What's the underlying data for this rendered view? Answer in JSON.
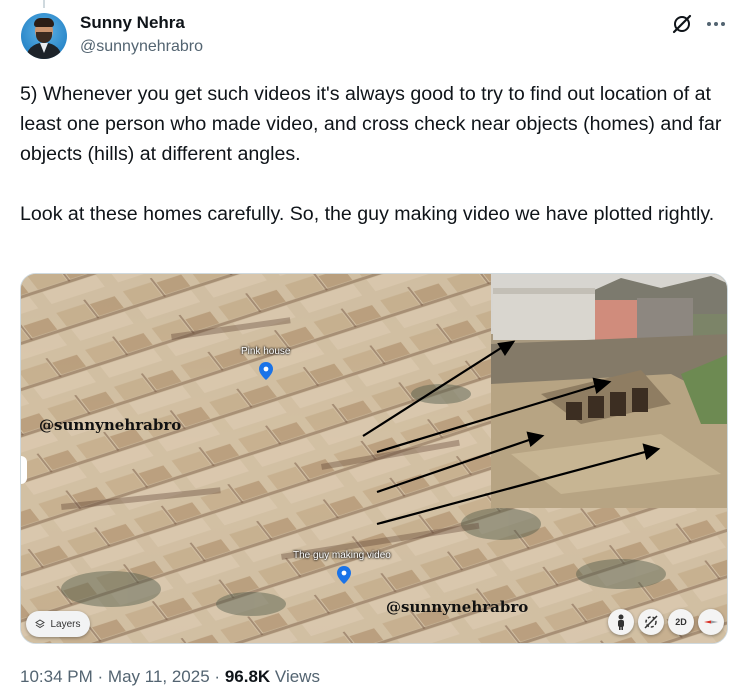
{
  "author": {
    "display_name": "Sunny Nehra",
    "handle": "@sunnynehrabro"
  },
  "header_actions": {
    "grok_icon": "grok-slash-icon",
    "more_icon": "more-dots-icon",
    "more_label": "···"
  },
  "tweet": {
    "paragraph_1": "5) Whenever you get such videos it's always good to try to find out location of at least one person who made video, and cross check near objects (homes) and far objects (hills) at different angles.",
    "paragraph_2": "Look at these homes carefully. So, the guy making video we have plotted rightly."
  },
  "media": {
    "watermark_top": "@sunnynehrabro",
    "watermark_bottom": "@sunnynehrabro",
    "place_1": "Pink house",
    "place_2": "The guy making video",
    "layers_label": "Layers",
    "ctrl_2d": "2D"
  },
  "meta": {
    "time": "10:34 PM",
    "sep1": "·",
    "date": "May 11, 2025",
    "sep2": "·",
    "views_count": "96.8K",
    "views_label": "Views"
  },
  "colors": {
    "text_primary": "#0f1419",
    "text_secondary": "#536471",
    "border": "#cfd9de",
    "pin_blue": "#1a73e8"
  }
}
